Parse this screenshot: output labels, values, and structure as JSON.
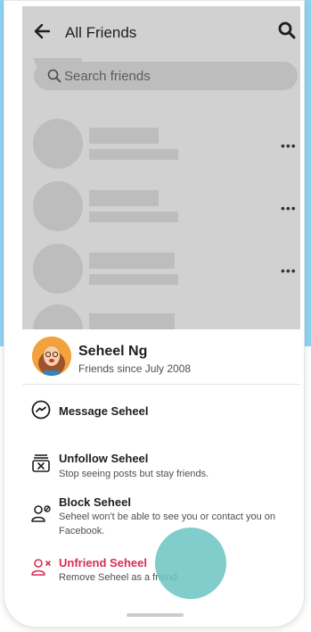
{
  "header": {
    "title": "All Friends"
  },
  "search": {
    "placeholder": "Search friends"
  },
  "list": {
    "more_glyph": "•••"
  },
  "profile": {
    "name": "Seheel Ng",
    "since": "Friends since July 2008"
  },
  "actions": [
    {
      "label": "Message Seheel",
      "desc": "",
      "icon": "messenger-icon"
    },
    {
      "label": "Unfollow Seheel",
      "desc": "Stop seeing posts but stay friends.",
      "icon": "unfollow-icon"
    },
    {
      "label": "Block Seheel",
      "desc": "Seheel won't be able to see you or contact you on Facebook.",
      "icon": "block-user-icon"
    },
    {
      "label": "Unfriend Seheel",
      "desc": "Remove Seheel as a friend.",
      "icon": "unfriend-icon"
    }
  ],
  "colors": {
    "overlay": "#d1d1d1",
    "danger": "#d62d52",
    "background_blue": "#8fd3f2",
    "touch_indicator": "#6fc6c4"
  }
}
